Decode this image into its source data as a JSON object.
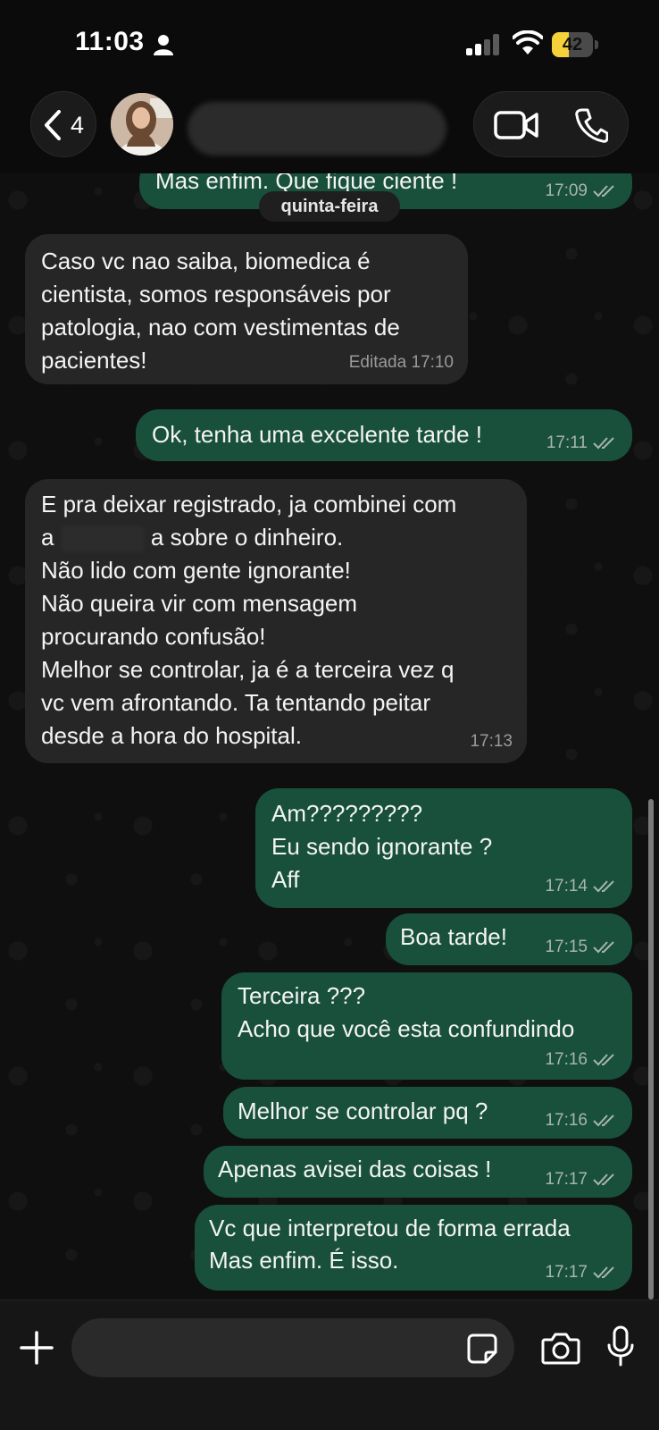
{
  "status_bar": {
    "time": "11:03",
    "battery": "42",
    "battery_level_percent": 42,
    "battery_color": "#f6d23a"
  },
  "header": {
    "back_count": "4"
  },
  "day_separator": "quinta-feira",
  "messages": [
    {
      "dir": "out",
      "text": "Mas enfim. Que fique ciente !",
      "time": "17:09"
    },
    {
      "dir": "in",
      "text": "Caso vc nao saiba, biomedica é\ncientista, somos responsáveis por\npatologia, nao com vestimentas de\npacientes!",
      "time": "Editada 17:10"
    },
    {
      "dir": "out",
      "text": "Ok, tenha uma excelente tarde !",
      "time": "17:11"
    },
    {
      "dir": "in",
      "text_before_redaction": "E pra deixar registrado, ja combinei com\na ",
      "text_after_redaction": " a sobre o dinheiro.\nNão lido com gente ignorante!\nNão queira vir com mensagem\nprocurando confusão!\nMelhor se controlar, ja é a terceira vez q\nvc vem afrontando. Ta tentando peitar\ndesde a hora do hospital.",
      "time": "17:13"
    },
    {
      "dir": "out",
      "text": "Am?????????\nEu sendo ignorante ?\nAff",
      "time": "17:14"
    },
    {
      "dir": "out",
      "text": "Boa tarde!",
      "time": "17:15"
    },
    {
      "dir": "out",
      "text": "Terceira ???\nAcho que você esta confundindo",
      "time": "17:16"
    },
    {
      "dir": "out",
      "text": "Melhor se controlar pq ?",
      "time": "17:16"
    },
    {
      "dir": "out",
      "text": "Apenas avisei das coisas !",
      "time": "17:17"
    },
    {
      "dir": "out",
      "text": "Vc que interpretou de forma errada\nMas enfim. É isso.",
      "time": "17:17"
    }
  ],
  "composer": {
    "placeholder": ""
  },
  "colors": {
    "outgoing_bubble": "#18503c",
    "incoming_bubble": "#262626",
    "background": "#0f0f0f",
    "read_ticks": "#a7b5ad"
  },
  "icons": [
    "person-icon",
    "signal-icon",
    "wifi-icon",
    "battery-icon",
    "chevron-left-icon",
    "video-call-icon",
    "phone-call-icon",
    "plus-icon",
    "sticker-icon",
    "camera-icon",
    "microphone-icon",
    "double-check-icon"
  ]
}
